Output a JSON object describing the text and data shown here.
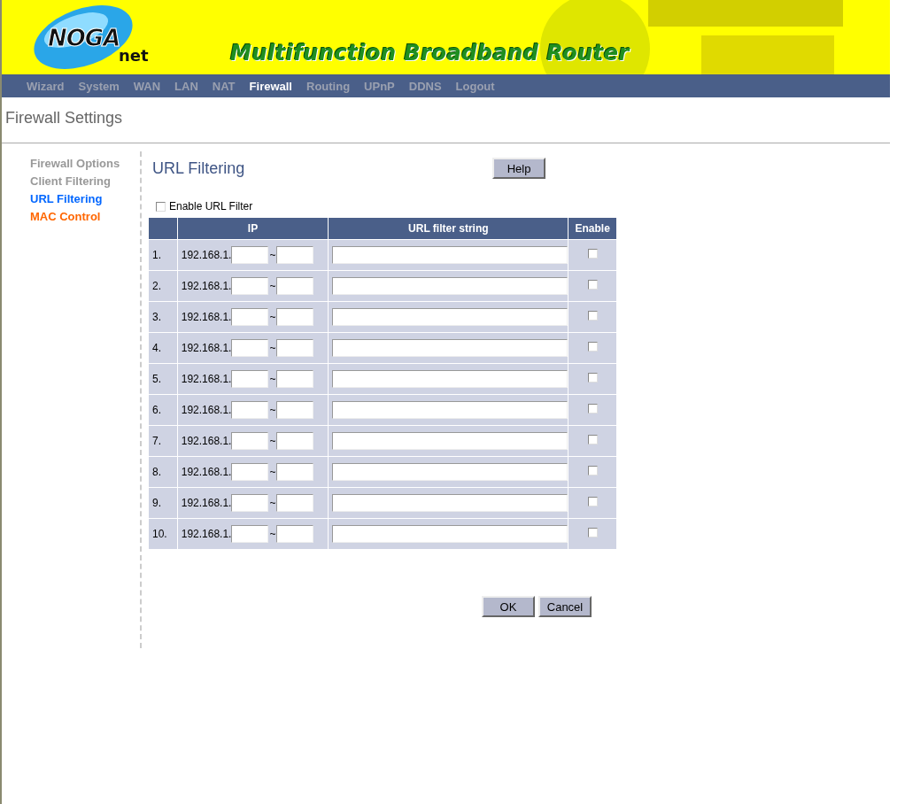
{
  "logo": {
    "word": "NOGA",
    "sub": "net"
  },
  "banner": {
    "title": "Multifunction Broadband Router"
  },
  "nav": [
    {
      "label": "Wizard",
      "selected": false
    },
    {
      "label": "System",
      "selected": false
    },
    {
      "label": "WAN",
      "selected": false
    },
    {
      "label": "LAN",
      "selected": false
    },
    {
      "label": "NAT",
      "selected": false
    },
    {
      "label": "Firewall",
      "selected": true
    },
    {
      "label": "Routing",
      "selected": false
    },
    {
      "label": "UPnP",
      "selected": false
    },
    {
      "label": "DDNS",
      "selected": false
    },
    {
      "label": "Logout",
      "selected": false
    }
  ],
  "page_title": "Firewall Settings",
  "sidebar": {
    "items": [
      {
        "label": "Firewall Options",
        "color": "#999999"
      },
      {
        "label": "Client Filtering",
        "color": "#999999"
      },
      {
        "label": "URL Filtering",
        "color": "#0066ff"
      },
      {
        "label": "MAC Control",
        "color": "#ff6600"
      }
    ]
  },
  "section_title": "URL Filtering",
  "help_button": "Help",
  "enable_filter": {
    "label": "Enable URL Filter",
    "checked": false
  },
  "table": {
    "columns": [
      "IP",
      "URL filter string",
      "Enable"
    ],
    "rows": [
      {
        "number": "1.",
        "ip_prefix": "192.168.1.",
        "separator": "~",
        "enabled": false
      },
      {
        "number": "2.",
        "ip_prefix": "192.168.1.",
        "separator": "~",
        "enabled": false
      },
      {
        "number": "3.",
        "ip_prefix": "192.168.1.",
        "separator": "~",
        "enabled": false
      },
      {
        "number": "4.",
        "ip_prefix": "192.168.1.",
        "separator": "~",
        "enabled": false
      },
      {
        "number": "5.",
        "ip_prefix": "192.168.1.",
        "separator": "~",
        "enabled": false
      },
      {
        "number": "6.",
        "ip_prefix": "192.168.1.",
        "separator": "~",
        "enabled": false
      },
      {
        "number": "7.",
        "ip_prefix": "192.168.1.",
        "separator": "~",
        "enabled": false
      },
      {
        "number": "8.",
        "ip_prefix": "192.168.1.",
        "separator": "~",
        "enabled": false
      },
      {
        "number": "9.",
        "ip_prefix": "192.168.1.",
        "separator": "~",
        "enabled": false
      },
      {
        "number": "10.",
        "ip_prefix": "192.168.1.",
        "separator": "~",
        "enabled": false
      }
    ]
  },
  "buttons": [
    "OK",
    "Cancel"
  ]
}
